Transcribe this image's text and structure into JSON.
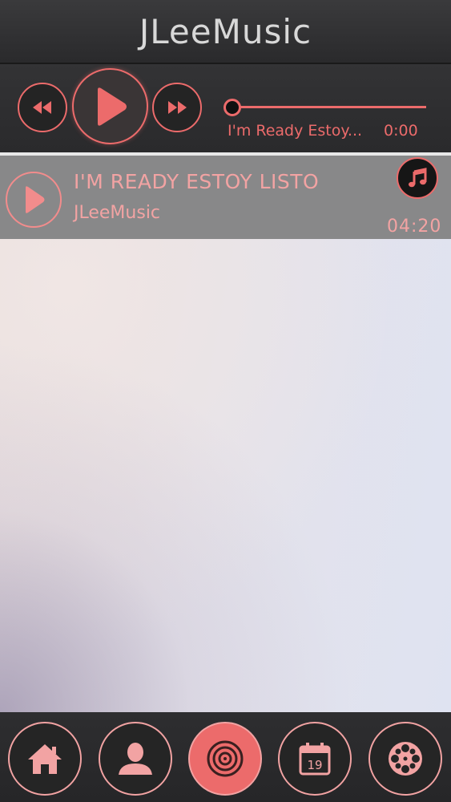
{
  "header": {
    "title": "JLeeMusic"
  },
  "player": {
    "rewind_icon": "rewind-icon",
    "play_icon": "play-icon",
    "fast_forward_icon": "fast-forward-icon",
    "progress": 0,
    "now_playing_title": "I'm Ready Estoy...",
    "elapsed": "0:00"
  },
  "songs": [
    {
      "title": "I'M READY ESTOY LISTO",
      "artist": "JLeeMusic",
      "duration": "04:20",
      "icon": "music-note-icon"
    }
  ],
  "nav": {
    "items": [
      {
        "icon": "home-icon",
        "active": false
      },
      {
        "icon": "profile-icon",
        "active": false
      },
      {
        "icon": "speaker-icon",
        "active": true
      },
      {
        "icon": "calendar-icon",
        "active": false,
        "calendar_day": "19"
      },
      {
        "icon": "film-reel-icon",
        "active": false
      }
    ]
  },
  "colors": {
    "accent": "#ec6b6b",
    "accent_light": "#f2a3a3",
    "bar_bg": "#2c2c2e",
    "row_bg": "#888889"
  }
}
